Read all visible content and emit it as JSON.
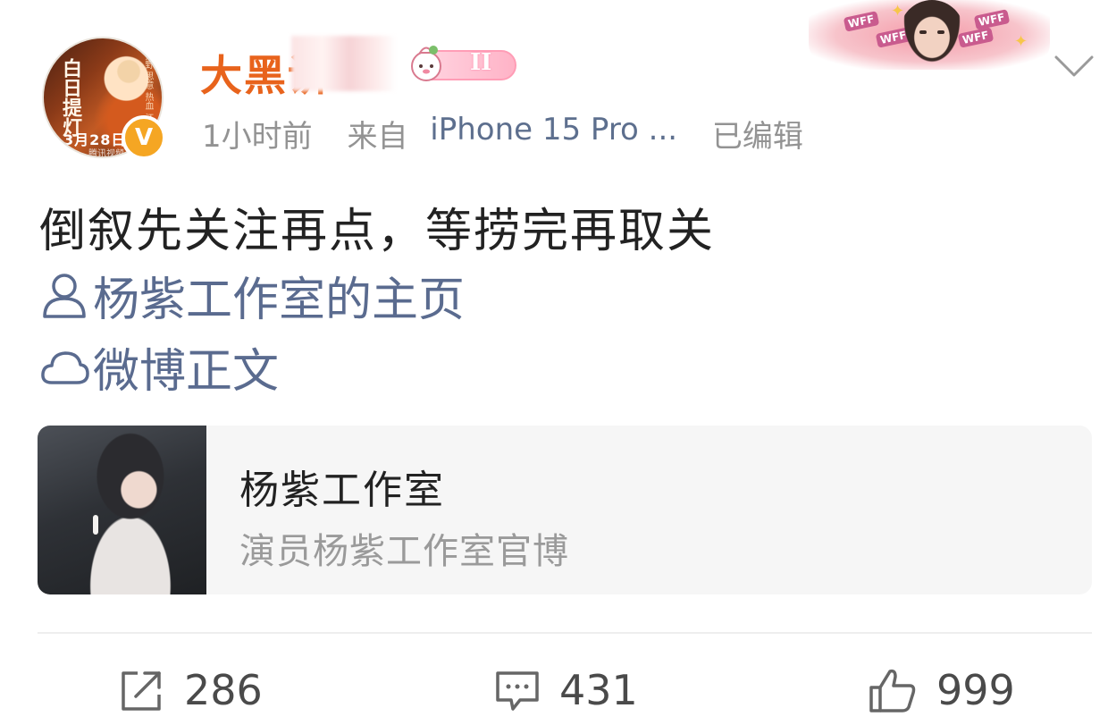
{
  "author": {
    "name": "大黑讲",
    "avatar_text": {
      "vertical_title": "白日提灯",
      "side_text": "文野 思意 热血 江湖",
      "date": "3月28日",
      "watermark": "腾讯视频"
    },
    "verified_badge": "V"
  },
  "member_badge": {
    "level": "II"
  },
  "decor_banner": {
    "tag": "WFF"
  },
  "meta": {
    "time": "1小时前",
    "source_prefix": "来自",
    "device": "iPhone 15 Pro ...",
    "edited": "已编辑"
  },
  "post": {
    "text": "倒叙先关注再点，等捞完再取关",
    "links": [
      {
        "icon": "user-icon",
        "label": "杨紫工作室的主页"
      },
      {
        "icon": "weibo-icon",
        "label": "微博正文"
      }
    ]
  },
  "card": {
    "title": "杨紫工作室",
    "subtitle": "演员杨紫工作室官博"
  },
  "actions": {
    "repost_count": "286",
    "comment_count": "431",
    "like_count": "999"
  },
  "colors": {
    "username": "#e8631c",
    "link": "#5a6b8f",
    "meta": "#939393",
    "verified": "#f5a623"
  }
}
